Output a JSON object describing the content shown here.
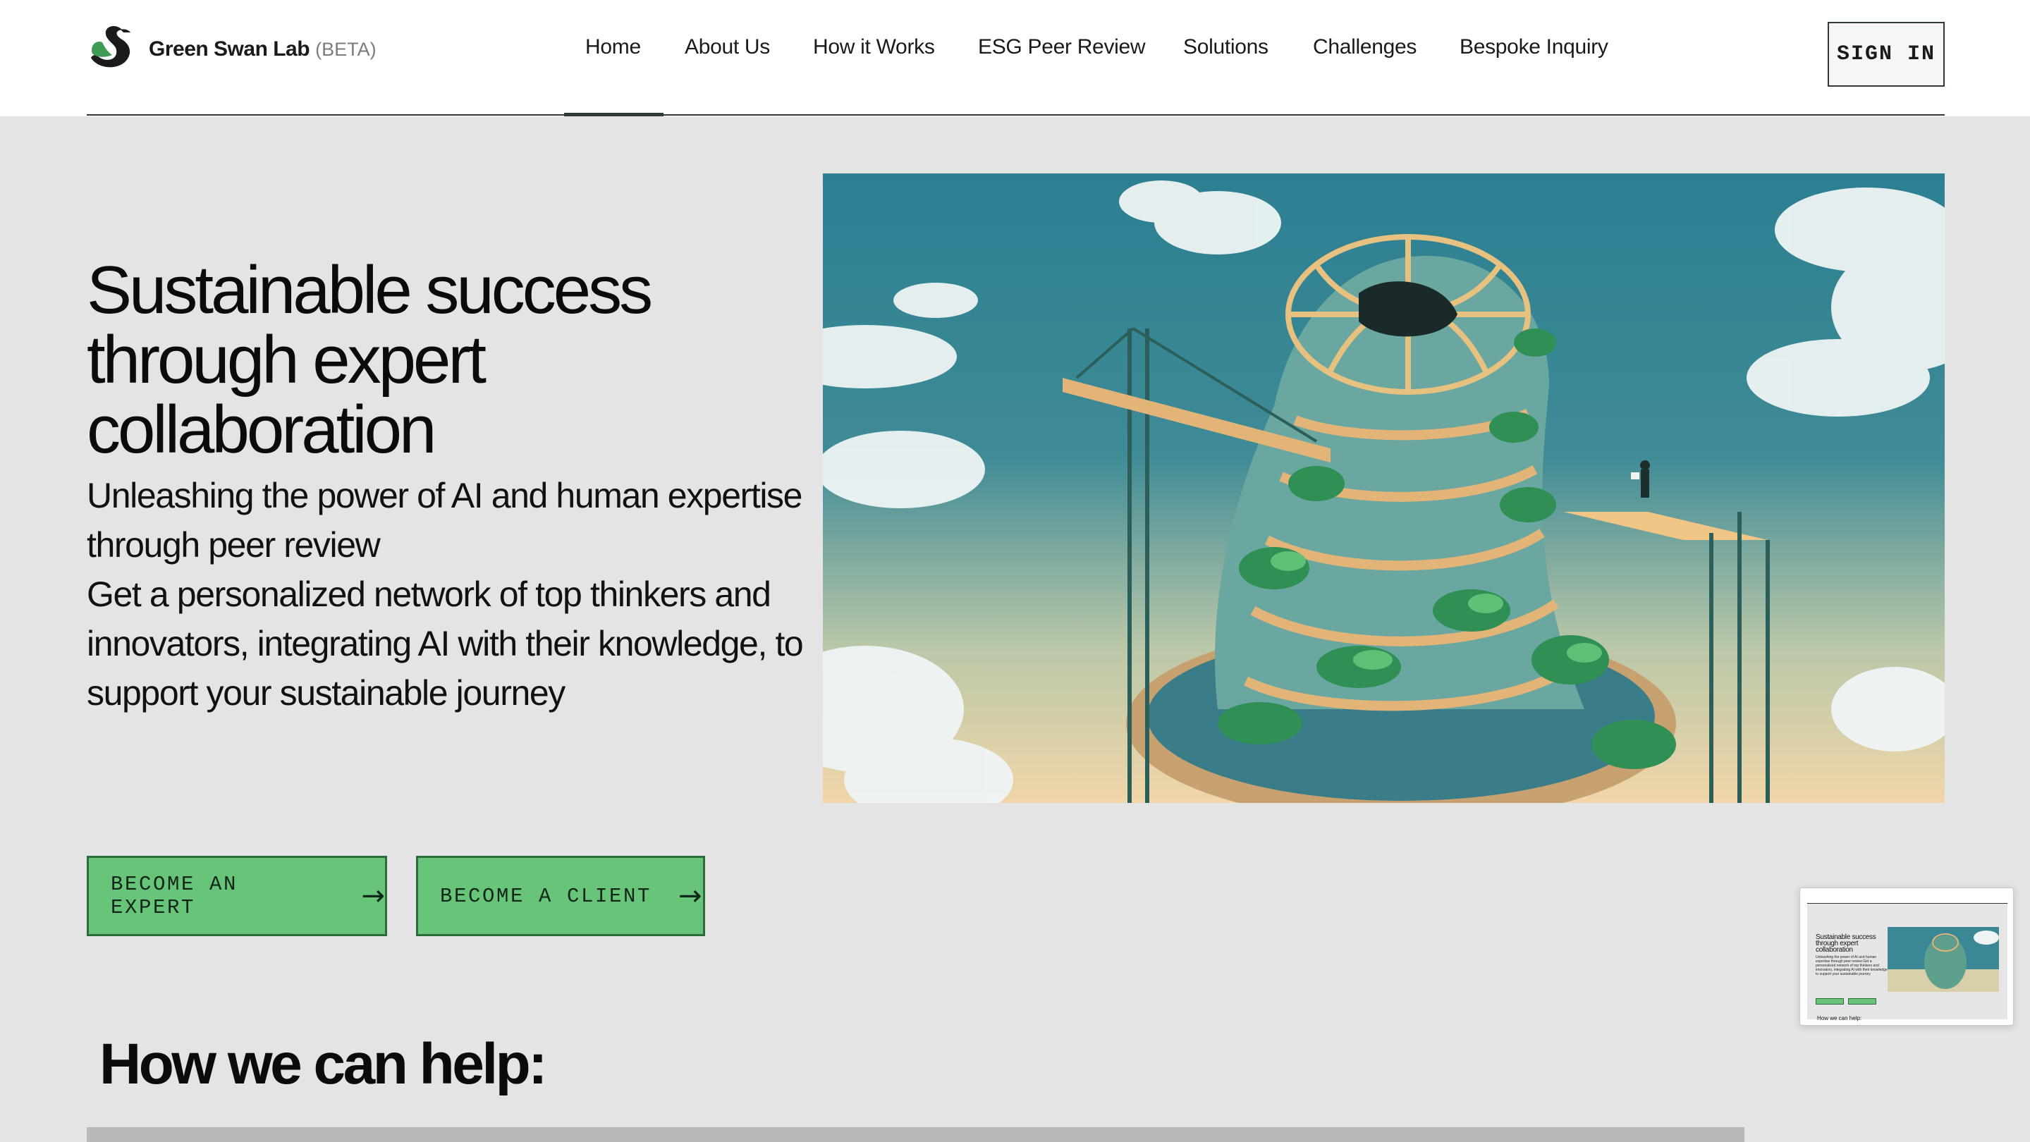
{
  "header": {
    "brand_name": "Green Swan Lab",
    "brand_badge": "(BETA)",
    "nav": [
      {
        "label": "Home",
        "active": true
      },
      {
        "label": "About Us"
      },
      {
        "label": "How it Works"
      },
      {
        "label": "ESG Peer Review"
      },
      {
        "label": "Solutions"
      },
      {
        "label": "Challenges"
      },
      {
        "label": "Bespoke Inquiry"
      }
    ],
    "sign_in_label": "SIGN IN"
  },
  "hero": {
    "title": "Sustainable success through expert collaboration",
    "subtitle_1": "Unleashing the power of AI and human expertise through peer review",
    "subtitle_2": "Get a personalized network of top thinkers and innovators, integrating AI with their knowledge, to support your sustainable journey",
    "image_icon": "tower-construction-illustration"
  },
  "cta": {
    "expert_label": "BECOME AN EXPERT",
    "client_label": "BECOME A CLIENT",
    "arrow_icon": "→"
  },
  "help": {
    "title": "How we can help:"
  },
  "thumbnail": {
    "title": "Sustainable success through expert collaboration",
    "help": "How we can help:"
  },
  "colors": {
    "page_bg": "#e4e4e4",
    "header_bg": "#ffffff",
    "cta_green": "#68c479",
    "cta_border": "#2d6b3c",
    "rule": "#2f3a36"
  }
}
